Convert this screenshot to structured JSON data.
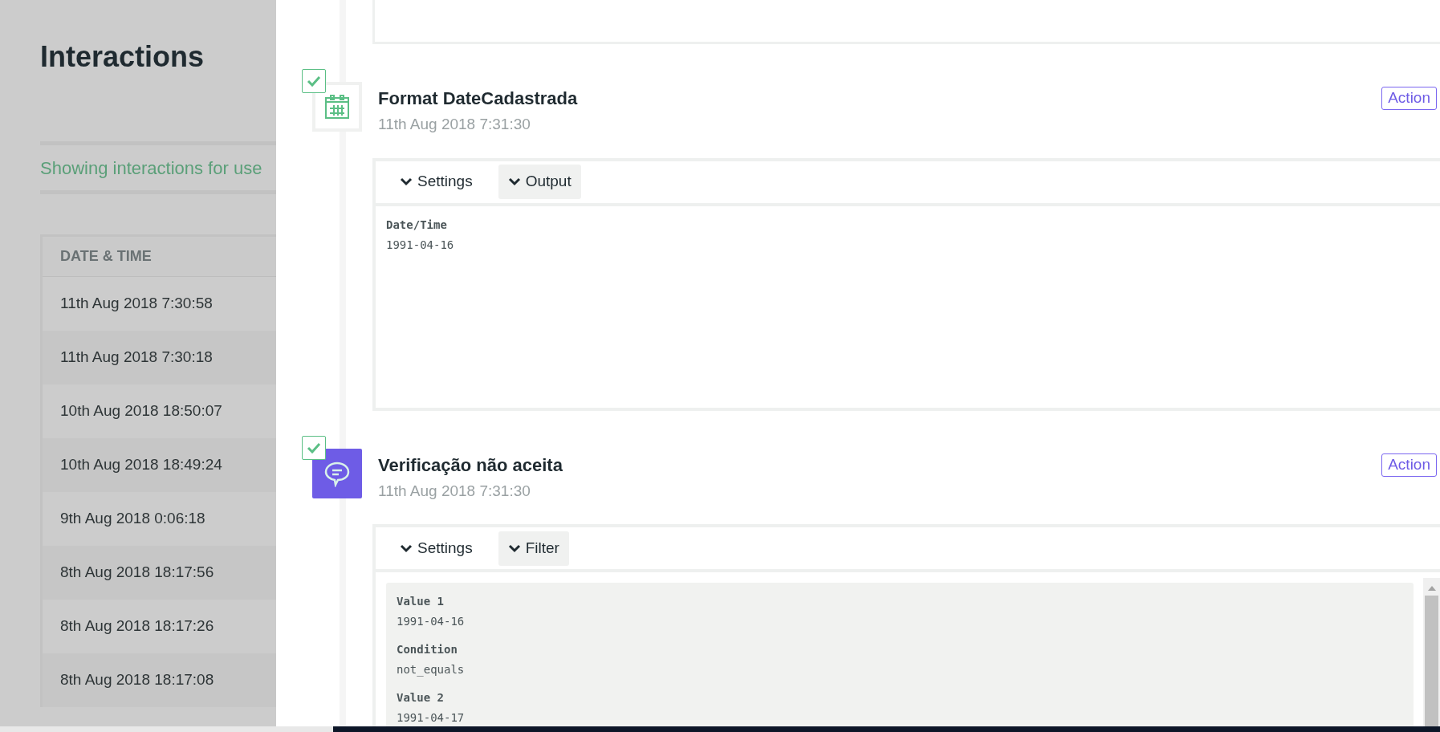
{
  "page": {
    "title": "Interactions",
    "notice": "Showing interactions for use"
  },
  "table": {
    "columns": [
      "DATE & TIME"
    ],
    "rows": [
      "11th Aug 2018 7:30:58",
      "11th Aug 2018 7:30:18",
      "10th Aug 2018 18:50:07",
      "10th Aug 2018 18:49:24",
      "9th Aug 2018 0:06:18",
      "8th Aug 2018 18:17:56",
      "8th Aug 2018 18:17:26",
      "8th Aug 2018 18:17:08"
    ]
  },
  "steps": [
    {
      "kind": "calendar",
      "checked": true,
      "title": "Format DateCadastrada",
      "time": "11th Aug 2018 7:31:30",
      "badge": "Action",
      "tabs": [
        {
          "label": "Settings",
          "selected": false
        },
        {
          "label": "Output",
          "selected": true
        }
      ],
      "boxed": false,
      "fields": [
        {
          "label": "Date/Time",
          "value": "1991-04-16"
        }
      ]
    },
    {
      "kind": "message",
      "checked": true,
      "title": "Verificação não aceita",
      "time": "11th Aug 2018 7:31:30",
      "badge": "Action",
      "tabs": [
        {
          "label": "Settings",
          "selected": false
        },
        {
          "label": "Filter",
          "selected": true
        }
      ],
      "boxed": true,
      "fields": [
        {
          "label": "Value 1",
          "value": "1991-04-16"
        },
        {
          "label": "Condition",
          "value": "not_equals"
        },
        {
          "label": "Value 2",
          "value": "1991-04-17"
        }
      ]
    }
  ]
}
